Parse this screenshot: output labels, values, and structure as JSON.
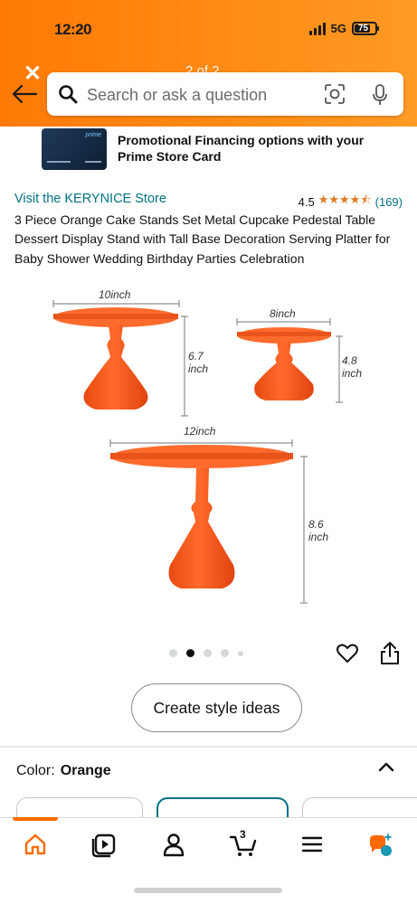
{
  "status": {
    "time": "12:20",
    "network": "5G",
    "battery": "75"
  },
  "header": {
    "close_icon": "close-icon",
    "counter": "2 of 2",
    "search_placeholder": "Search or ask a question",
    "icons": [
      "back-arrow-icon",
      "search-icon",
      "camera-lens-icon",
      "microphone-icon"
    ],
    "accent": "#ff8b14"
  },
  "promo": {
    "text": "Promotional Financing options with your Prime Store Card",
    "card_label": "prime"
  },
  "product": {
    "store": "Visit the KERYNICE Store",
    "rating": "4.5",
    "stars": "★★★★⯪",
    "review_count": "(169)",
    "title": "3 Piece Orange Cake Stands Set Metal Cupcake Pedestal Table Dessert Display Stand with Tall Base Decoration Serving Platter for Baby Shower Wedding Birthday Parties Celebration",
    "stand_color": "#ff5a1a"
  },
  "image": {
    "dims": {
      "stand1_width": "10inch",
      "stand1_height": "6.7 inch",
      "stand2_width": "8inch",
      "stand2_height": "4.8 inch",
      "stand3_width": "12inch",
      "stand3_height": "8.6 inch"
    },
    "dots": 5,
    "active_dot": 2
  },
  "actions": {
    "create_style_ideas": "Create style ideas"
  },
  "variant": {
    "label": "Color:",
    "value": "Orange"
  },
  "nav": {
    "items": [
      "home-icon",
      "video-icon",
      "account-icon",
      "cart-icon",
      "menu-icon",
      "rufus-icon"
    ],
    "cart_count": "3",
    "active_color": "#ff6a00"
  }
}
